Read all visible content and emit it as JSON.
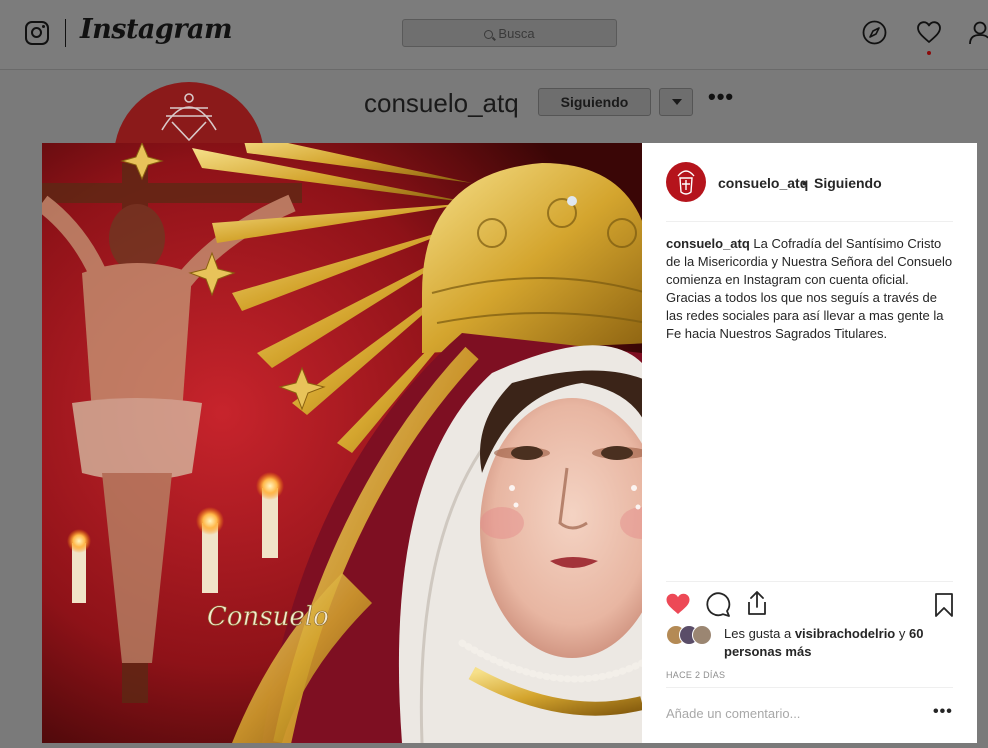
{
  "nav": {
    "wordmark": "Instagram",
    "search_placeholder": "Busca",
    "icons": [
      "instagram-glyph-icon",
      "explore-compass-icon",
      "activity-heart-icon",
      "profile-icon"
    ]
  },
  "profile_bg": {
    "username": "consuelo_atq",
    "follow_button": "Siguiendo",
    "more": "•••"
  },
  "post": {
    "header_user": "consuelo_atq",
    "header_separator": "•",
    "header_follow": "Siguiendo",
    "caption_user": "consuelo_atq",
    "caption_line1": "La Cofradía del Santísimo Cristo de la Misericordia y Nuestra Señora del Consuelo comienza en Instagram con cuenta oficial.",
    "caption_line2": "Gracias a todos los que nos seguís a través de las redes sociales para así llevar a mas gente la Fe hacia Nuestros Sagrados Titulares.",
    "likes_prefix": "Les gusta a ",
    "likes_user": "visibrachodelrio",
    "likes_middle": " y ",
    "likes_count": "60 personas más",
    "timestamp": "HACE 2 DÍAS",
    "comment_placeholder": "Añade un comentario...",
    "comment_more": "•••",
    "photo_text": "Consuelo",
    "liked": true
  },
  "colors": {
    "like_red": "#ed4956",
    "accent_red": "#b5141c",
    "text": "#262626",
    "muted": "#8e8e8e"
  }
}
